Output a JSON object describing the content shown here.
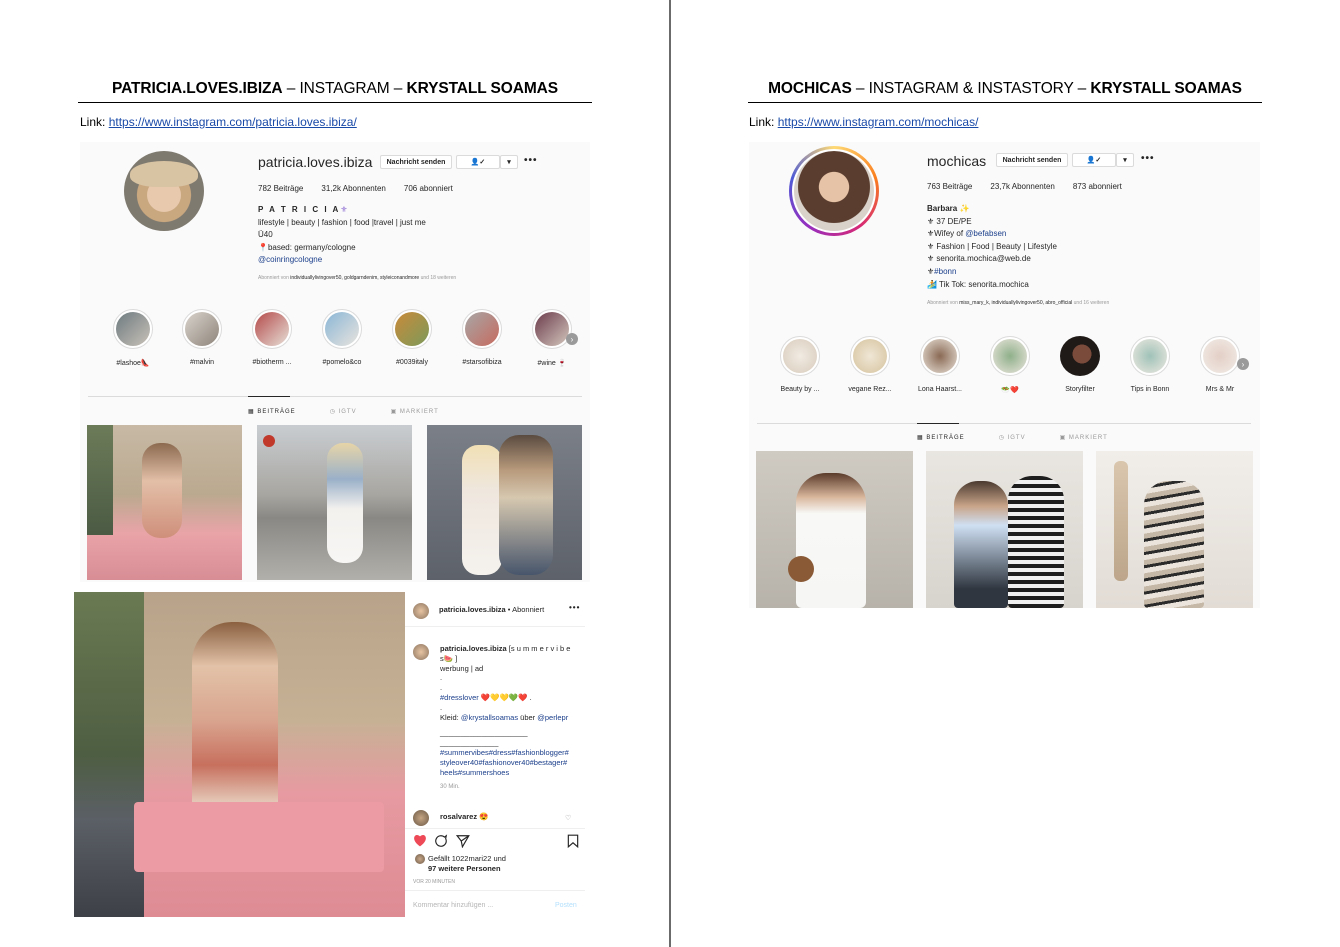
{
  "left": {
    "title": {
      "bold1": "PATRICIA.LOVES.IBIZA",
      "mid": " – INSTAGRAM – ",
      "bold2": "KRYSTALL SOAMAS"
    },
    "link_label": "Link: ",
    "link_url": "https://www.instagram.com/patricia.loves.ibiza/",
    "profile": {
      "username": "patricia.loves.ibiza",
      "message_button": "Nachricht senden",
      "posts": "782 Beiträge",
      "followers": "31,2k Abonnenten",
      "following": "706 abonniert",
      "name": "P A T R I C I A",
      "bio": [
        "lifestyle | beauty | fashion | food |travel | just me",
        "Ü40",
        "📍based: germany/cologne"
      ],
      "bio_link": "@coinringcologne",
      "followed_by_prefix": "Abonniert von ",
      "followed_by_names": "individuallylivingover50, goldgarndenim, styleiconandmore",
      "followed_by_suffix": " und 18 weiteren"
    },
    "highlights": [
      "#lashoe👠",
      "#malvin",
      "#biotherm ...",
      "#pomelo&co",
      "#0039italy",
      "#starsofibiza",
      "#wine 🍷"
    ],
    "tabs": [
      "▦ BEITRÄGE",
      "◷ IGTV",
      "▣ MARKIERT"
    ],
    "post": {
      "username": "patricia.loves.ibiza",
      "header_suffix": " • Abonniert",
      "caption_user": "patricia.loves.ibiza",
      "caption_lines": [
        "[s u m m e r v i b e",
        "s🍉 ]",
        "werbung | ad",
        ".",
        "."
      ],
      "hashtag_dress": "#dresslover",
      "hearts": " ❤️💛💛💚❤️ .",
      "dot": ".",
      "kleid_prefix": "Kleid: ",
      "kleid_user": "@krystallsoamas",
      "kleid_mid": " über ",
      "kleid_user2": "@perlepr",
      "dash_line": "_____________________",
      "dash_line2": "______________",
      "hashtags": [
        "#summervibes#dress#fashionblogger#",
        "styleover40#fashionover40#bestager#",
        "heels#summershoes"
      ],
      "time": "30 Min.",
      "comment_user": "rosalvarez",
      "comment_emoji": "😍",
      "likes_line1": "Gefällt 1022mari22 und",
      "likes_line2": "97 weitere Personen",
      "ago": "VOR 20 MINUTEN",
      "comment_placeholder": "Kommentar hinzufügen ...",
      "post_button": "Posten"
    }
  },
  "right": {
    "title": {
      "bold1": "MOCHICAS",
      "mid": " – INSTAGRAM & INSTASTORY – ",
      "bold2": "KRYSTALL SOAMAS"
    },
    "link_label": "Link: ",
    "link_url": "https://www.instagram.com/mochicas/",
    "profile": {
      "username": "mochicas",
      "message_button": "Nachricht senden",
      "posts": "763 Beiträge",
      "followers": "23,7k Abonnenten",
      "following": "873 abonniert",
      "name": "Barbara ✨",
      "bio": [
        "⚜ 37 DE/PE"
      ],
      "bio_wifey": "⚜Wifey of ",
      "bio_wifey_link": "@befabsen",
      "bio_more": [
        "⚜ Fashion | Food | Beauty | Lifestyle",
        "⚜ senorita.mochica@web.de"
      ],
      "bio_bonn": "#bonn",
      "bio_bonn_prefix": "⚜",
      "bio_tiktok": "🏄 Tik Tok: senorita.mochica",
      "followed_by_prefix": "Abonniert von ",
      "followed_by_names": "miss_mary_k, individuallylivingover50, abro_official",
      "followed_by_suffix": " und 16 weiteren"
    },
    "highlights": [
      "Beauty by ...",
      "vegane Rez...",
      "Lona Haarst...",
      "🥗❤️",
      "Storyfilter",
      "Tips in Bonn",
      "Mrs & Mr"
    ],
    "tabs": [
      "▦ BEITRÄGE",
      "◷ IGTV",
      "▣ MARKIERT"
    ]
  },
  "colors": {
    "ig_bg": "#fafafa",
    "link_blue": "#1a4aa8",
    "tag_blue": "#1b3f8b",
    "heart_red": "#ed4956"
  }
}
